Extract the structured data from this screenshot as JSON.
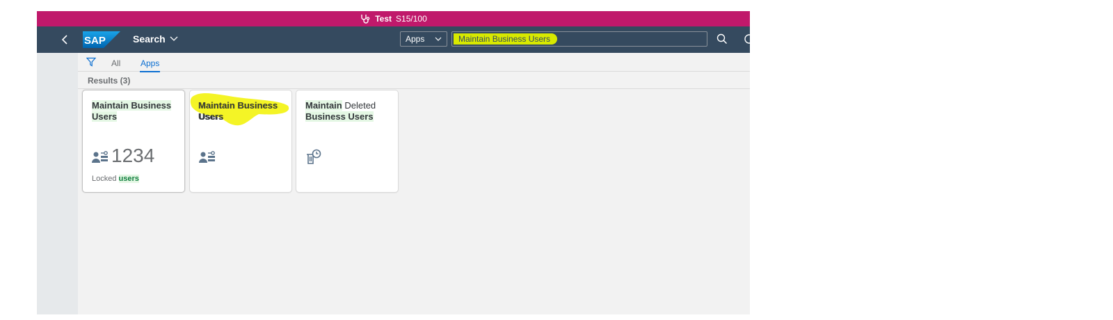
{
  "env_bar": {
    "name": "Test",
    "system": "S15/100",
    "color": "#c0196b"
  },
  "shell": {
    "back_icon": "chevron-left-icon",
    "logo": "SAP",
    "title": "Search",
    "scope_select": "Apps",
    "search_value": "Maintain Business Users",
    "search_icon": "search-icon",
    "color": "#354a5f"
  },
  "tabs": {
    "all": "All",
    "apps": "Apps",
    "active": "Apps"
  },
  "results_label": "Results (3)",
  "tiles": [
    {
      "title_bold": "Maintain Business Users",
      "icon": "user-settings-icon",
      "number": "1234",
      "footer_plain": "Locked ",
      "footer_bold": "users"
    },
    {
      "title_bold": "Maintain Business Users",
      "icon": "user-settings-icon"
    },
    {
      "title_bold_1": "Maintain",
      "title_plain": " Deleted ",
      "title_bold_2": "Business Users",
      "icon": "delete-history-icon"
    }
  ],
  "colors": {
    "highlight": "#d8e900",
    "accent": "#0a6ed1",
    "match": "#107e3e"
  }
}
